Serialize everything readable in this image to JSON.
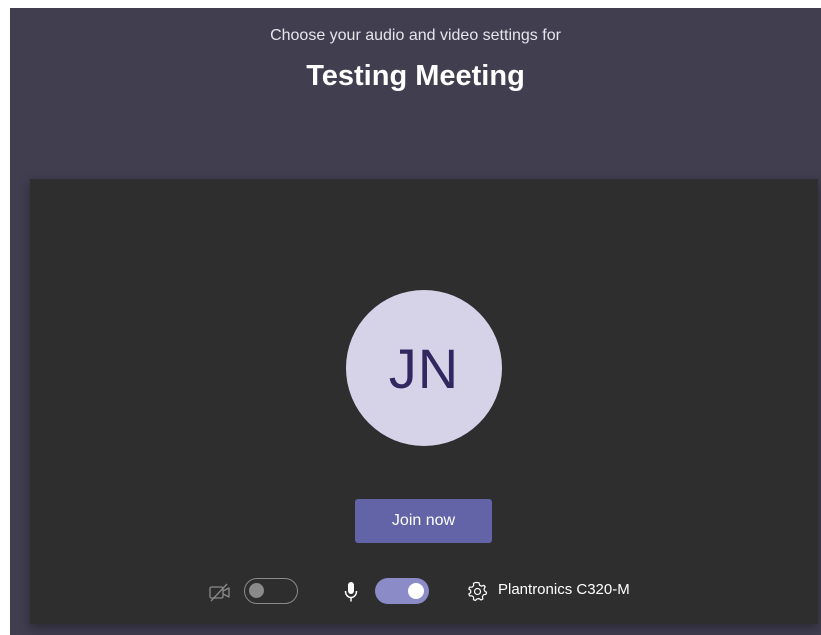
{
  "header": {
    "subtitle": "Choose your audio and video settings for",
    "meeting_title": "Testing Meeting"
  },
  "preview": {
    "avatar_initials": "JN",
    "join_label": "Join now"
  },
  "controls": {
    "camera_enabled": false,
    "mic_enabled": true,
    "device_label": "Plantronics C320-M"
  },
  "colors": {
    "header_bg": "#403e4f",
    "preview_bg": "#2e2e2e",
    "accent": "#6264a7",
    "toggle_on": "#8b8cc7",
    "avatar_bg": "#d6d3e9",
    "avatar_text": "#33275f"
  },
  "icons": {
    "camera": "camera-off-icon",
    "mic": "microphone-icon",
    "settings": "gear-icon"
  }
}
